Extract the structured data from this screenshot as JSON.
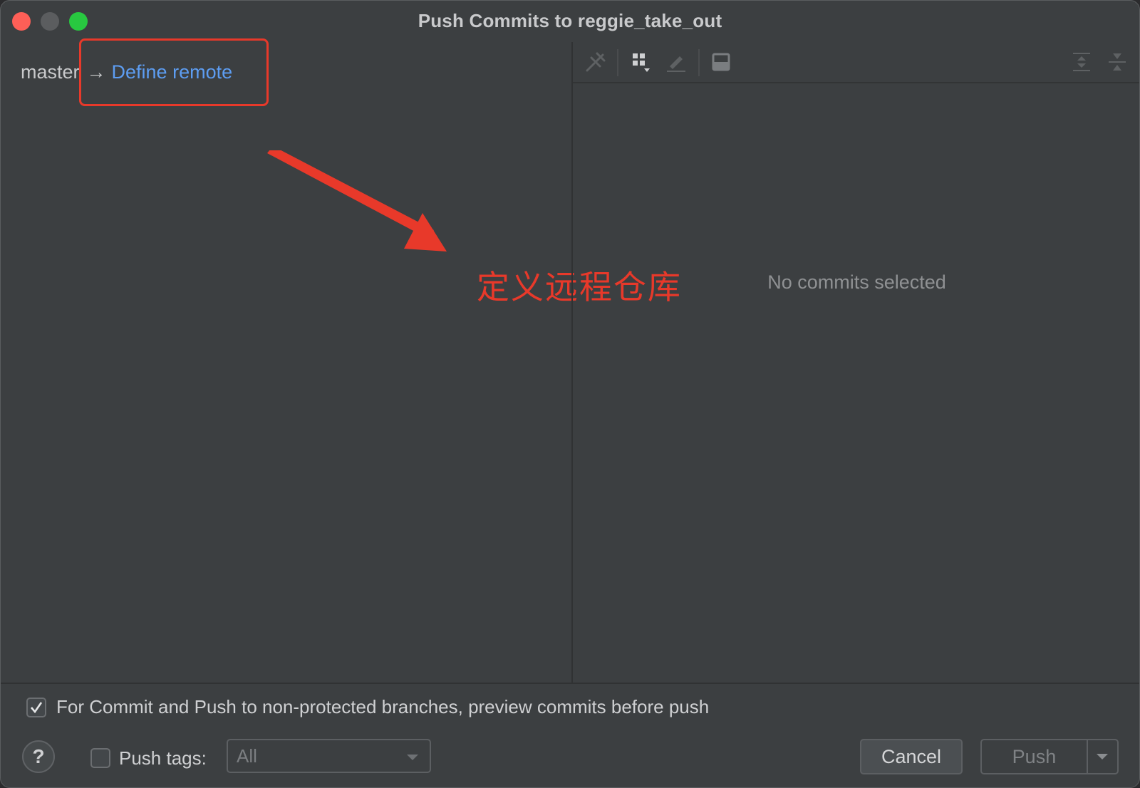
{
  "window": {
    "title": "Push Commits to reggie_take_out"
  },
  "branch": {
    "local": "master",
    "arrow": "→",
    "remote_link": "Define remote"
  },
  "annotation": {
    "label": "定义远程仓库"
  },
  "details": {
    "empty_text": "No commits selected"
  },
  "toolbar": {
    "icons": [
      "cherry-pick-icon",
      "group-by-icon",
      "edit-icon",
      "preview-panel-icon",
      "expand-all-icon",
      "collapse-all-icon"
    ]
  },
  "options": {
    "preview_label": "For Commit and Push to non-protected branches, preview commits before push",
    "preview_checked": true,
    "push_tags_label": "Push tags:",
    "push_tags_checked": false,
    "push_tags_value": "All"
  },
  "buttons": {
    "help": "?",
    "cancel": "Cancel",
    "push": "Push"
  },
  "colors": {
    "accent_link": "#5d9df2",
    "annotation_red": "#e8392a"
  }
}
